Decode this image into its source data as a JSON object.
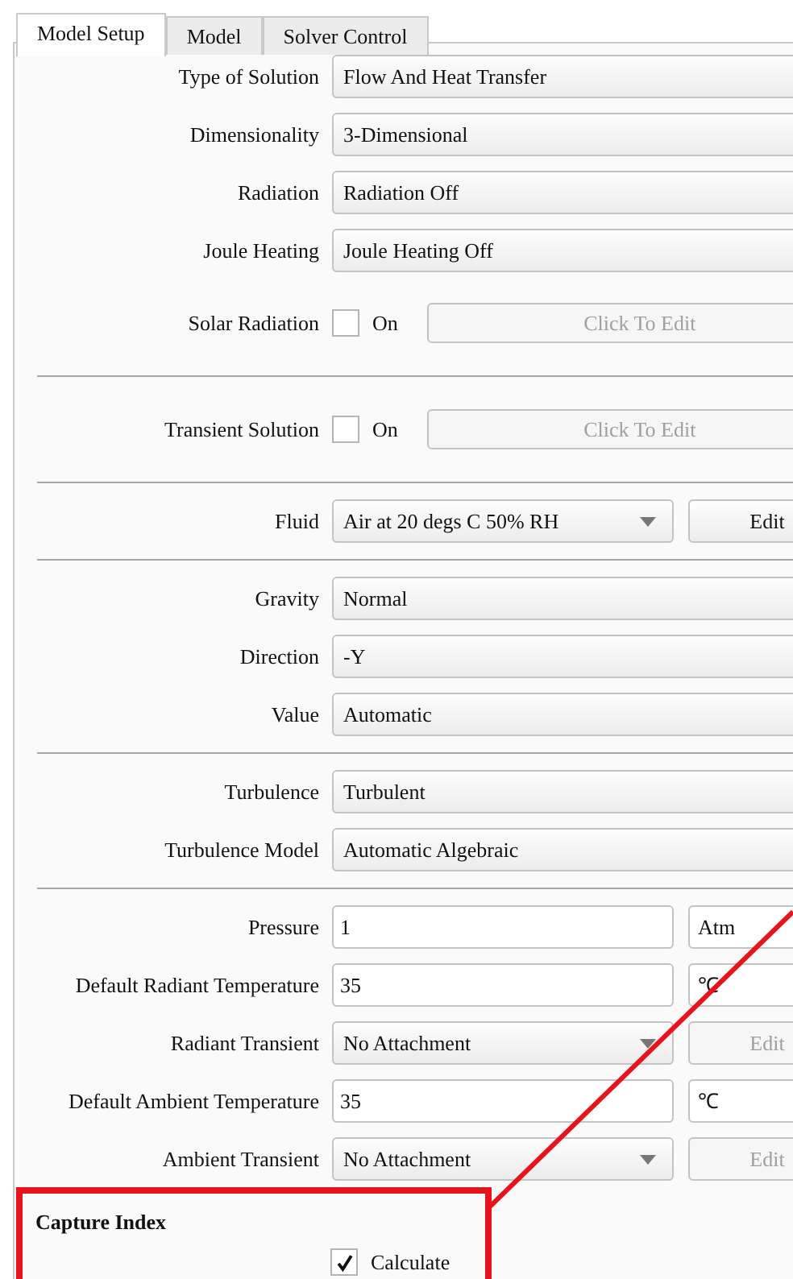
{
  "tabs": [
    {
      "label": "Model Setup",
      "selected": true
    },
    {
      "label": "Model",
      "selected": false
    },
    {
      "label": "Solver Control",
      "selected": false
    }
  ],
  "sections": [
    {
      "rows": [
        {
          "kind": "select",
          "label": "Type of Solution",
          "value": "Flow And Heat Transfer"
        },
        {
          "kind": "select",
          "label": "Dimensionality",
          "value": "3-Dimensional"
        },
        {
          "kind": "select",
          "label": "Radiation",
          "value": "Radiation Off"
        },
        {
          "kind": "select",
          "label": "Joule Heating",
          "value": "Joule Heating Off"
        },
        {
          "kind": "toggle",
          "label": "Solar Radiation",
          "checked": false,
          "option": "On",
          "button": "Click To Edit",
          "disabled": true
        }
      ]
    },
    {
      "rows": [
        {
          "kind": "toggle",
          "label": "Transient Solution",
          "checked": false,
          "option": "On",
          "button": "Click To Edit",
          "disabled": true
        }
      ]
    },
    {
      "rows": [
        {
          "kind": "dropdown",
          "label": "Fluid",
          "value": "Air at 20 degs C 50% RH",
          "button": "Edit",
          "disabled": false
        }
      ]
    },
    {
      "rows": [
        {
          "kind": "select",
          "label": "Gravity",
          "value": "Normal"
        },
        {
          "kind": "select",
          "label": "Direction",
          "value": "-Y"
        },
        {
          "kind": "select",
          "label": "Value",
          "value": "Automatic"
        }
      ]
    },
    {
      "rows": [
        {
          "kind": "select",
          "label": "Turbulence",
          "value": "Turbulent"
        },
        {
          "kind": "select",
          "label": "Turbulence Model",
          "value": "Automatic Algebraic"
        }
      ]
    },
    {
      "rows": [
        {
          "kind": "input",
          "label": "Pressure",
          "value": "1",
          "unit": "Atm"
        },
        {
          "kind": "input",
          "label": "Default Radiant Temperature",
          "value": "35",
          "unit": "℃"
        },
        {
          "kind": "dropdown",
          "label": "Radiant Transient",
          "value": "No Attachment",
          "button": "Edit",
          "disabled": true
        },
        {
          "kind": "input",
          "label": "Default Ambient Temperature",
          "value": "35",
          "unit": "℃"
        },
        {
          "kind": "dropdown",
          "label": "Ambient Transient",
          "value": "No Attachment",
          "button": "Edit",
          "disabled": true
        }
      ]
    }
  ],
  "capture_index": {
    "title": "Capture Index",
    "option": "Calculate",
    "checked": true,
    "highlighted": true
  }
}
